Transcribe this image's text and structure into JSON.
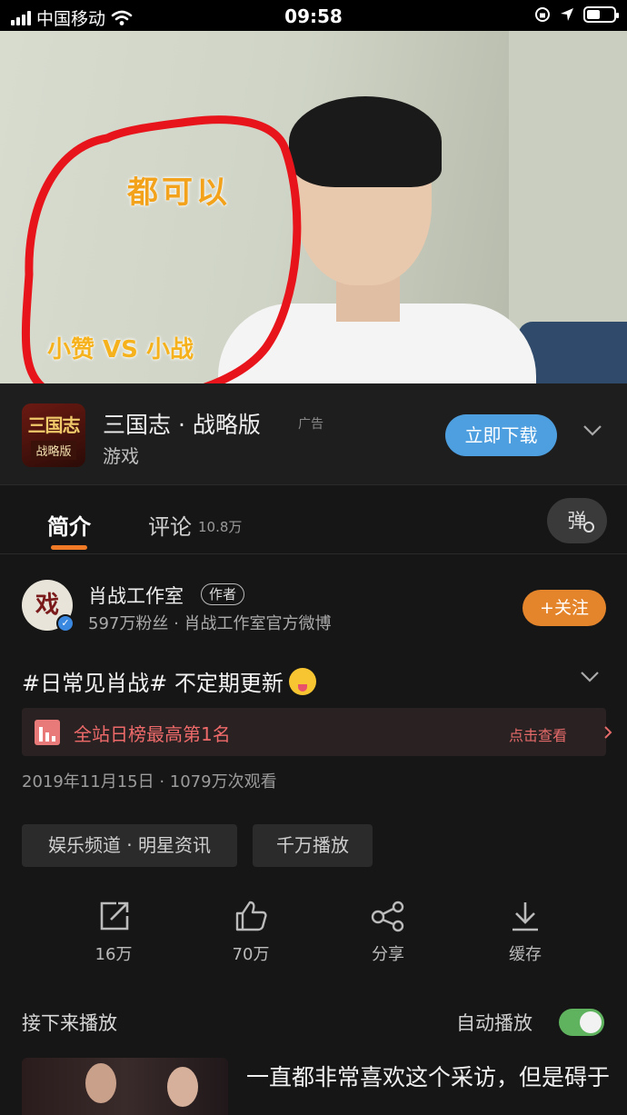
{
  "status_bar": {
    "carrier": "中国移动",
    "time": "09:58"
  },
  "video": {
    "overlay_main": "都可以",
    "overlay_sub": "小赞 VS 小战"
  },
  "ad": {
    "logo_line1": "三国志",
    "logo_line2": "战略版",
    "title": "三国志 · 战略版",
    "tag": "广告",
    "subtitle": "游戏",
    "download_label": "立即下载"
  },
  "tabs": [
    {
      "label": "简介"
    },
    {
      "label": "评论",
      "count": "10.8万"
    }
  ],
  "danmaku_label": "弹",
  "author": {
    "avatar_text": "戏",
    "name": "肖战工作室",
    "badge": "作者",
    "meta": "597万粉丝 · 肖战工作室官方微博",
    "follow_label": "+关注"
  },
  "description": "#日常见肖战# 不定期更新",
  "rank": {
    "text": "全站日榜最高第1名",
    "view_label": "点击查看"
  },
  "date_line": "2019年11月15日 · 1079万次观看",
  "chips": [
    "娱乐频道 · 明星资讯",
    "千万播放"
  ],
  "actions": [
    {
      "icon": "share-out-icon",
      "label": "16万"
    },
    {
      "icon": "thumbs-up-icon",
      "label": "70万"
    },
    {
      "icon": "share-nodes-icon",
      "label": "分享"
    },
    {
      "icon": "download-icon",
      "label": "缓存"
    }
  ],
  "up_next": {
    "title": "接下来播放",
    "autoplay_label": "自动播放",
    "autoplay_on": true,
    "next_video_title": "一直都非常喜欢这个采访，但是碍于"
  },
  "colors": {
    "accent_orange": "#e4852c",
    "download_blue": "#4e9fe0",
    "rank_red": "#ee6a6a",
    "toggle_green": "#5fb35f"
  }
}
